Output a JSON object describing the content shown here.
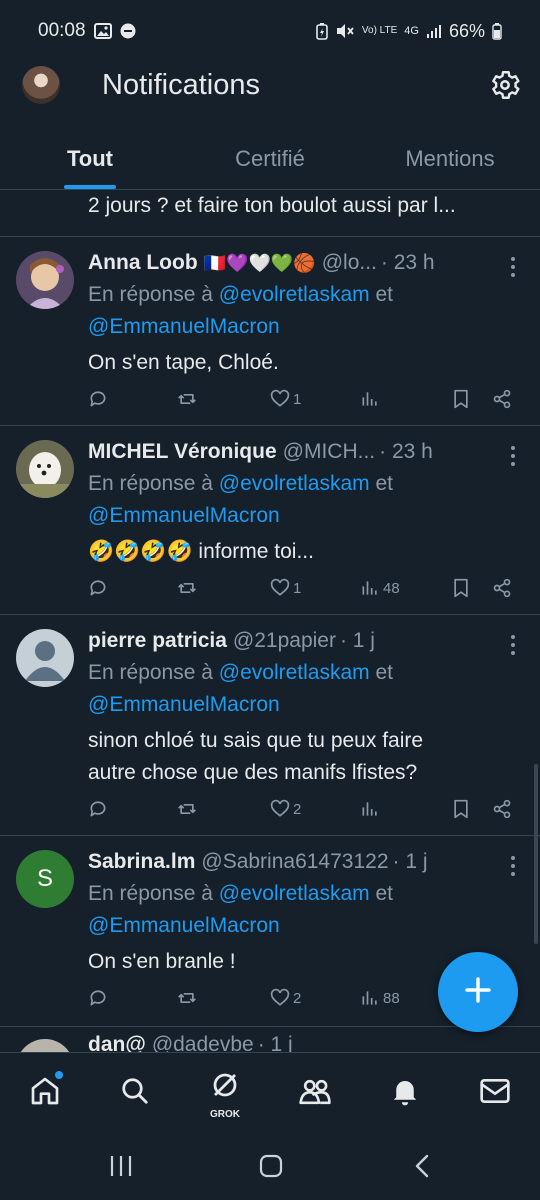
{
  "status_bar": {
    "time": "00:08",
    "battery": "66%",
    "network": "4G",
    "volte": "Vo) LTE"
  },
  "header": {
    "title": "Notifications"
  },
  "tabs": [
    {
      "label": "Tout",
      "active": true
    },
    {
      "label": "Certifié",
      "active": false
    },
    {
      "label": "Mentions",
      "active": false
    }
  ],
  "feed": {
    "partial_text": "2 jours ? et faire ton boulot aussi par l...",
    "tweets": [
      {
        "name": "Anna Loob",
        "emoji": "🇫🇷💜🤍💚🏀",
        "handle": "@lo...",
        "time": "· 23 h",
        "reply_prefix": "En réponse à",
        "reply_user1": "@evolretlaskam",
        "reply_and": "et",
        "reply_user2": "@EmmanuelMacron",
        "text": "On s'en tape, Chloé.",
        "likes": "1",
        "views": ""
      },
      {
        "name": "MICHEL Véronique",
        "emoji": "",
        "handle": "@MICH...",
        "time": "· 23 h",
        "reply_prefix": "En réponse à",
        "reply_user1": "@evolretlaskam",
        "reply_and": "et",
        "reply_user2": "@EmmanuelMacron",
        "text": "🤣🤣🤣🤣 informe toi...",
        "likes": "1",
        "views": "48"
      },
      {
        "name": "pierre patricia",
        "emoji": "",
        "handle": "@21papier",
        "time": "· 1 j",
        "reply_prefix": "En réponse à",
        "reply_user1": "@evolretlaskam",
        "reply_and": "et",
        "reply_user2": "@EmmanuelMacron",
        "text_line1": "sinon chloé tu sais que tu peux faire",
        "text_line2": "autre chose que des manifs lfistes?",
        "likes": "2",
        "views": ""
      },
      {
        "name": "Sabrina.lm",
        "emoji": "",
        "handle": "@Sabrina61473122",
        "time": "· 1 j",
        "avatar_letter": "S",
        "reply_prefix": "En réponse à",
        "reply_user1": "@evolretlaskam",
        "reply_and": "et",
        "reply_user2": "@EmmanuelMacron",
        "text": "On s'en branle !",
        "likes": "2",
        "views": "88"
      },
      {
        "name": "dan@",
        "handle": "@dadevbe",
        "time": "· 1 j"
      }
    ]
  },
  "bottom_nav": {
    "grok_label": "GROK"
  },
  "colors": {
    "background": "#15202b",
    "accent": "#1d9bf0",
    "muted": "#8b98a5",
    "text": "#e7e9ea",
    "divider": "#38444d"
  }
}
